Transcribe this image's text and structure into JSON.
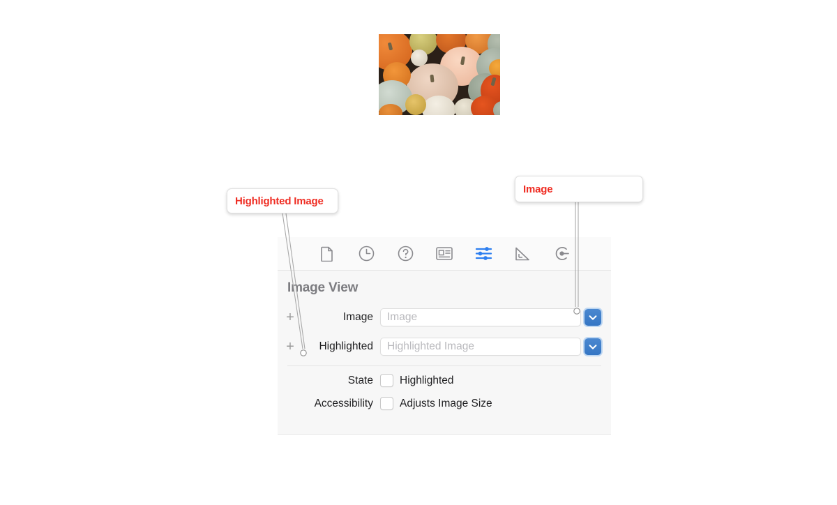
{
  "image_preview": {
    "alt": "assorted pumpkins and gourds photo",
    "palette": [
      "#e2701f",
      "#f3c3a6",
      "#a9b5a4",
      "#e8e3d6",
      "#d8542a",
      "#c9852a"
    ]
  },
  "callouts": [
    {
      "id": "highlighted",
      "label": "Highlighted Image",
      "color": "#ef2d23"
    },
    {
      "id": "image",
      "label": "Image",
      "color": "#ef2d23"
    }
  ],
  "inspector": {
    "toolbar": {
      "icons": [
        {
          "name": "file-inspector-icon",
          "selected": false
        },
        {
          "name": "quick-help-clock-icon",
          "selected": false
        },
        {
          "name": "help-question-icon",
          "selected": false
        },
        {
          "name": "identity-card-icon",
          "selected": false
        },
        {
          "name": "attributes-sliders-icon",
          "selected": true
        },
        {
          "name": "size-ruler-icon",
          "selected": false
        },
        {
          "name": "connections-icon",
          "selected": false
        }
      ],
      "accent_color": "#2d7ff0"
    },
    "section_title": "Image View",
    "combo_rows": [
      {
        "add_glyph": "+",
        "label": "Image",
        "value": "",
        "placeholder": "Image",
        "dropdown": "chevron-down-icon"
      },
      {
        "add_glyph": "+",
        "label": "Highlighted",
        "value": "",
        "placeholder": "Highlighted Image",
        "dropdown": "chevron-down-icon"
      }
    ],
    "check_rows": [
      {
        "label": "State",
        "text": "Highlighted",
        "checked": false
      },
      {
        "label": "Accessibility",
        "text": "Adjusts Image Size",
        "checked": false
      }
    ]
  }
}
